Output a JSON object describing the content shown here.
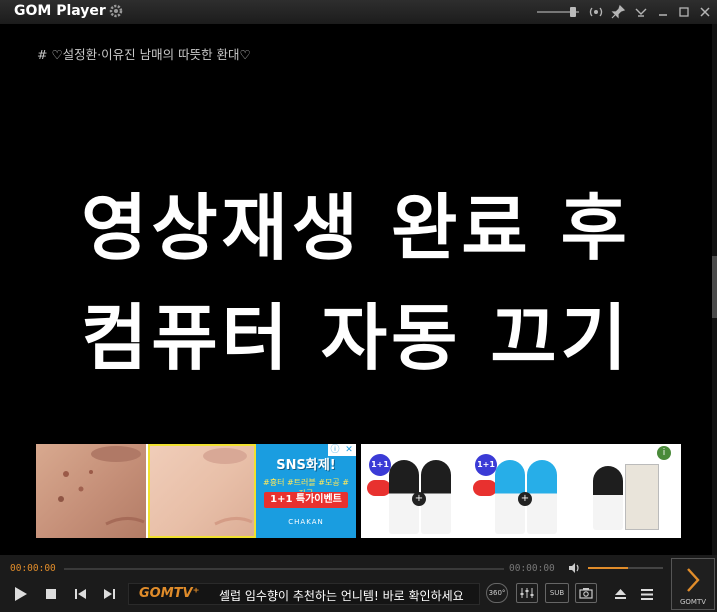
{
  "window": {
    "title": "GOM Player"
  },
  "video": {
    "caption": "# ♡설정환·이유진 남매의 따뜻한 환대♡",
    "headline_line1": "영상재생 완료 후",
    "headline_line2": "컴퓨터 자동 끄기"
  },
  "ad_left": {
    "sns": "SNS화제!",
    "tags": "#흉터 #트러블 #모공 #자국",
    "promo": "1+1 특가이벤트",
    "brand": "CHAKAN"
  },
  "ad_right": {
    "badge": "1+1"
  },
  "controls": {
    "time_current": "00:00:00",
    "time_total": "00:00:00",
    "ticker_brand": "GOMTV⁺",
    "ticker_text": "셀럽 임수향이 추천하는 언니템! 바로 확인하세요",
    "btn_360": "360°",
    "btn_sub": "SUB",
    "gomtv_label": "GOMTV"
  },
  "icons": {
    "settings": "gear-icon",
    "pin": "pin-icon",
    "radio": "broadcast-icon",
    "play": "play-icon",
    "stop": "stop-icon",
    "prev": "skip-previous-icon",
    "next": "skip-next-icon",
    "eq": "equalizer-icon",
    "capture": "camera-icon",
    "eject": "eject-icon",
    "menu": "menu-icon",
    "volume": "volume-icon",
    "chevron": "chevron-right-icon"
  },
  "colors": {
    "accent": "#e08c2a",
    "background": "#000000",
    "controlbar": "#1b1b1b"
  }
}
